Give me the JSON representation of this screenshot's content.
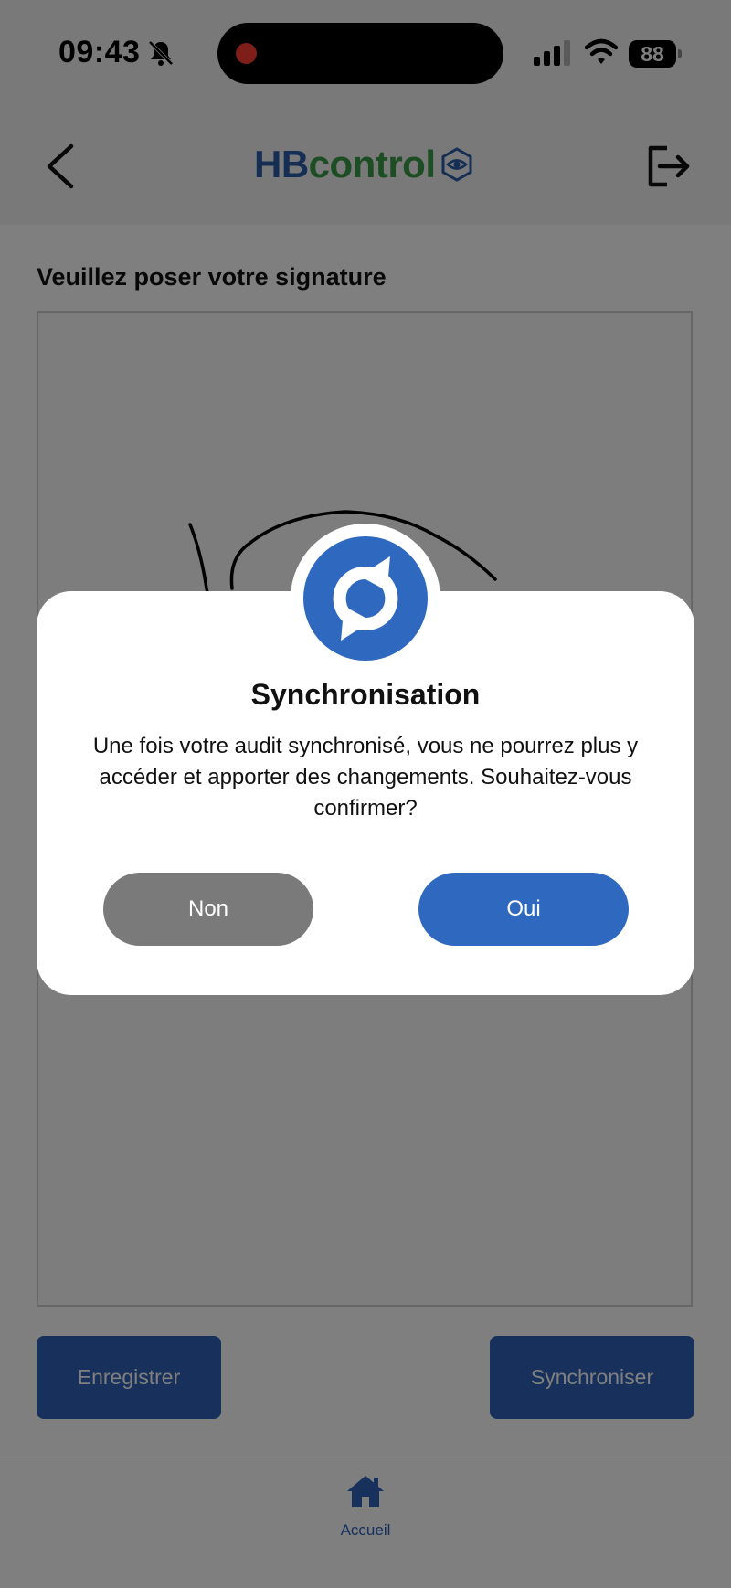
{
  "status_bar": {
    "time": "09:43",
    "battery_level": "88",
    "icons": [
      "bell-slash-icon",
      "signal-icon",
      "wifi-icon",
      "battery-icon"
    ]
  },
  "header": {
    "logo_primary": "HB",
    "logo_secondary": "control",
    "logo_primary_color": "#2b5da8",
    "logo_secondary_color": "#3a9a46",
    "back_icon": "chevron-left-icon",
    "logout_icon": "logout-icon"
  },
  "signature": {
    "title": "Veuillez poser votre signature"
  },
  "actions": {
    "save_label": "Enregistrer",
    "sync_label": "Synchroniser",
    "button_color": "#2e63b8"
  },
  "tabbar": {
    "home_label": "Accueil",
    "home_icon": "home-icon"
  },
  "dialog": {
    "icon": "sync-icon",
    "title": "Synchronisation",
    "message": "Une fois votre audit synchronisé, vous ne pourrez plus y accéder et apporter des changements. Souhaitez-vous confirmer?",
    "cancel_label": "Non",
    "confirm_label": "Oui",
    "cancel_color": "#7a7a7a",
    "confirm_color": "#2e68bf"
  }
}
